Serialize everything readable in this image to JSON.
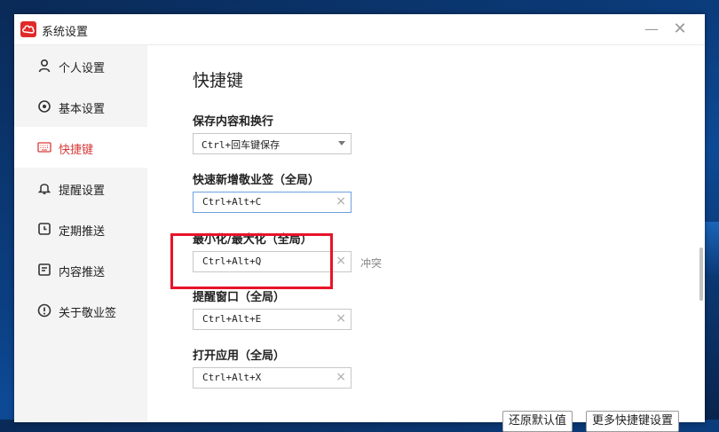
{
  "window": {
    "title": "系统设置"
  },
  "sidebar": {
    "items": [
      {
        "label": "个人设置",
        "icon": "person-icon"
      },
      {
        "label": "基本设置",
        "icon": "gear-icon"
      },
      {
        "label": "快捷键",
        "icon": "keyboard-icon",
        "active": true
      },
      {
        "label": "提醒设置",
        "icon": "bell-icon"
      },
      {
        "label": "定期推送",
        "icon": "clock-icon"
      },
      {
        "label": "内容推送",
        "icon": "document-icon"
      },
      {
        "label": "关于敬业签",
        "icon": "info-icon"
      }
    ]
  },
  "main": {
    "title": "快捷键",
    "shortcuts": [
      {
        "label": "保存内容和换行",
        "value": "Ctrl+回车键保存",
        "type": "select"
      },
      {
        "label": "快速新增敬业签（全局）",
        "value": "Ctrl+Alt+C",
        "type": "input"
      },
      {
        "label": "最小化/最大化（全局）",
        "value": "Ctrl+Alt+Q",
        "type": "input",
        "conflict": "冲突"
      },
      {
        "label": "提醒窗口（全局）",
        "value": "Ctrl+Alt+E",
        "type": "input"
      },
      {
        "label": "打开应用（全局）",
        "value": "Ctrl+Alt+X",
        "type": "input"
      }
    ],
    "buttons": {
      "restore": "还原默认值",
      "more": "更多快捷键设置"
    }
  },
  "colors": {
    "accent": "#d93a3a",
    "highlight": "#e8132a",
    "focus_border": "#6aa2e0"
  }
}
